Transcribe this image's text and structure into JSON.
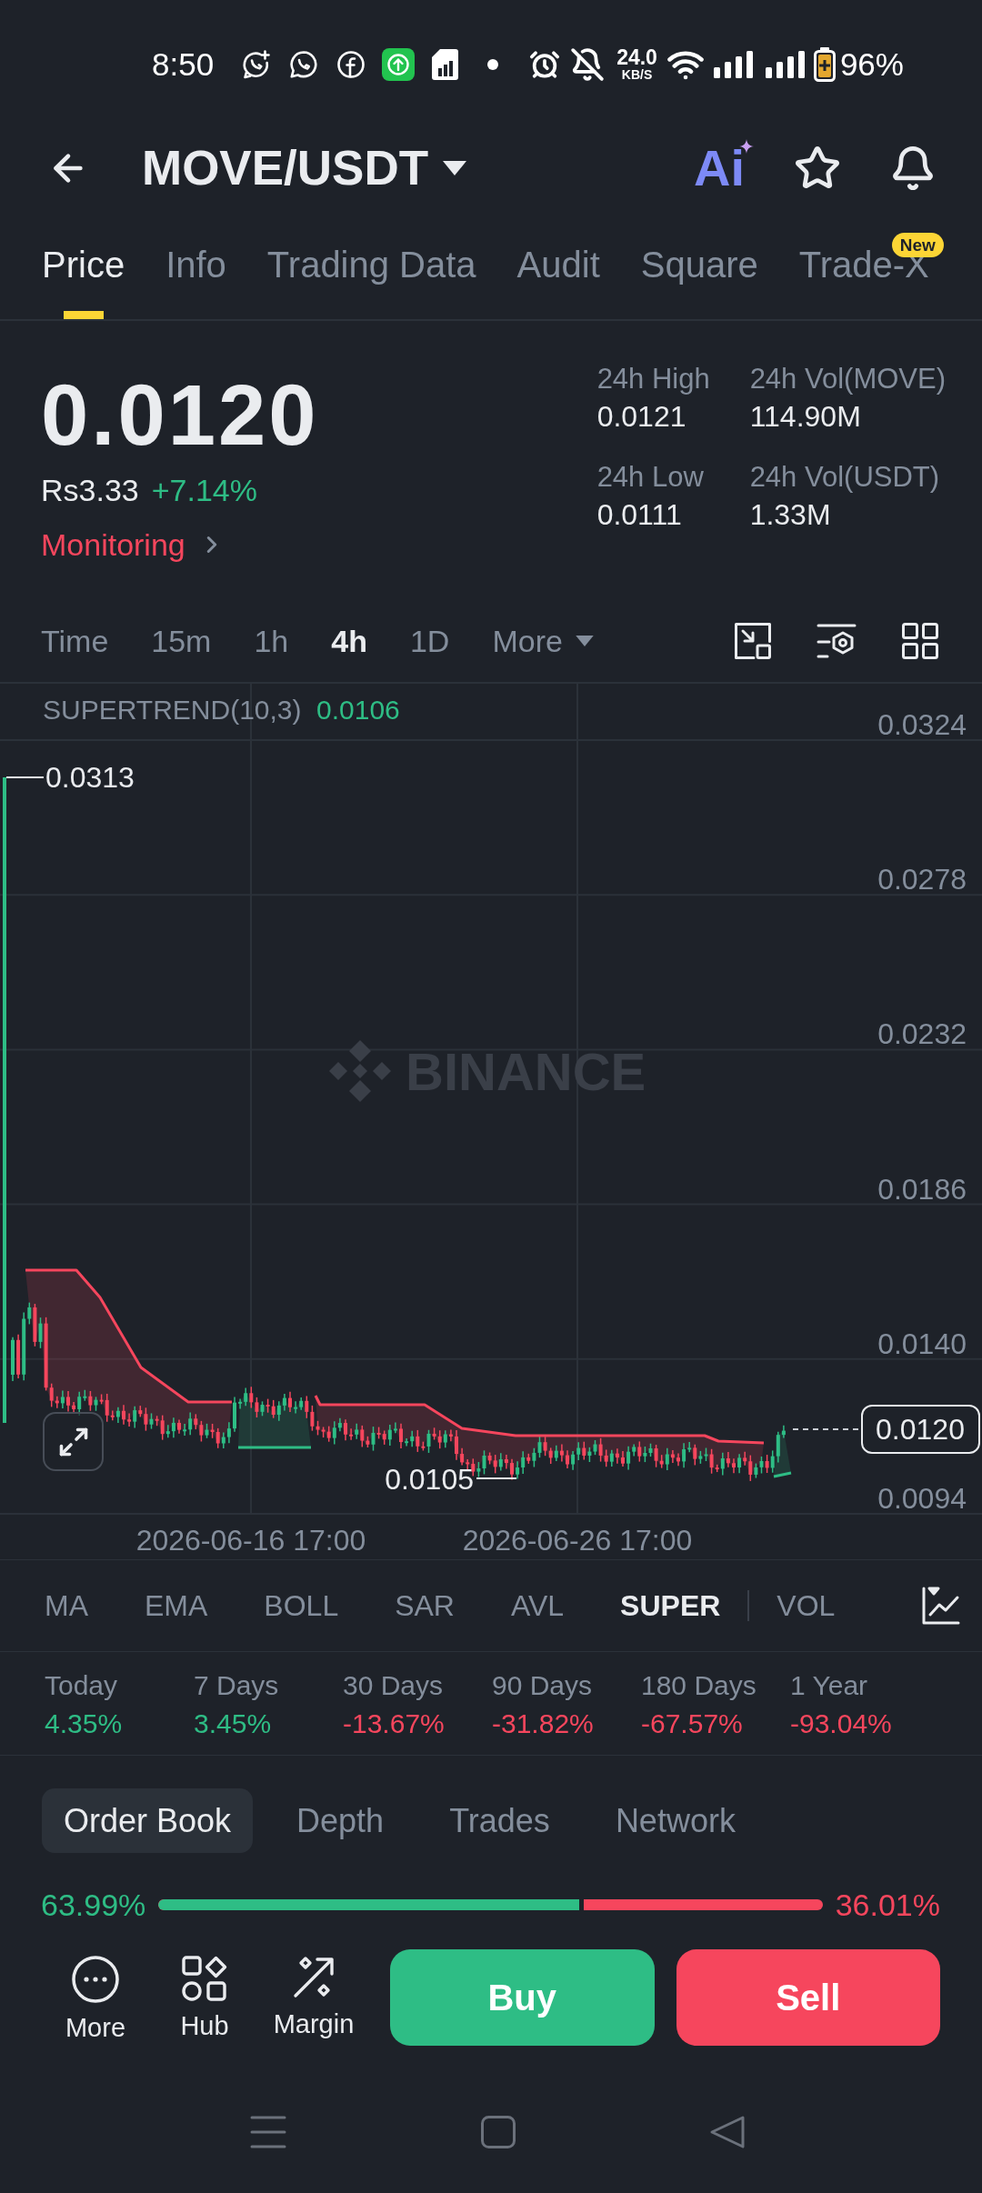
{
  "status_bar": {
    "time": "8:50",
    "net_speed": "24.0",
    "net_speed_unit": "KB/S",
    "battery": "96%"
  },
  "header": {
    "pair": "MOVE/USDT",
    "ai_label": "Ai"
  },
  "tabs": [
    {
      "label": "Price",
      "selected": true
    },
    {
      "label": "Info",
      "selected": false
    },
    {
      "label": "Trading Data",
      "selected": false
    },
    {
      "label": "Audit",
      "selected": false
    },
    {
      "label": "Square",
      "selected": false
    },
    {
      "label": "Trade-X",
      "selected": false,
      "badge": "New"
    }
  ],
  "price": {
    "last": "0.0120",
    "fiat": "Rs3.33",
    "change": "+7.14%",
    "monitoring": "Monitoring"
  },
  "stats": [
    {
      "label": "24h High",
      "value": "0.0121"
    },
    {
      "label": "24h Vol(MOVE)",
      "value": "114.90M"
    },
    {
      "label": "24h Low",
      "value": "0.0111"
    },
    {
      "label": "24h Vol(USDT)",
      "value": "1.33M"
    }
  ],
  "intervals": [
    {
      "label": "Time",
      "kind": "option",
      "selected": false
    },
    {
      "label": "15m",
      "kind": "option",
      "selected": false
    },
    {
      "label": "1h",
      "kind": "option",
      "selected": false
    },
    {
      "label": "4h",
      "kind": "option",
      "selected": true
    },
    {
      "label": "1D",
      "kind": "option",
      "selected": false
    },
    {
      "label": "More",
      "kind": "menu",
      "selected": false
    }
  ],
  "chart": {
    "indicator": "SUPERTREND(10,3)",
    "indicator_value": "0.0106",
    "watermark": "BINANCE",
    "price_ticks": [
      "0.0324",
      "0.0278",
      "0.0232",
      "0.0186",
      "0.0140",
      "0.0094"
    ],
    "time_labels": [
      "2026-06-16 17:00",
      "2026-06-26 17:00"
    ],
    "high_marker": "0.0313",
    "low_marker": "0.0105",
    "last_price": "0.0120"
  },
  "main_indicators": [
    {
      "label": "MA",
      "selected": false
    },
    {
      "label": "EMA",
      "selected": false
    },
    {
      "label": "BOLL",
      "selected": false
    },
    {
      "label": "SAR",
      "selected": false
    },
    {
      "label": "AVL",
      "selected": false
    },
    {
      "label": "SUPER",
      "selected": true
    }
  ],
  "sub_indicators": [
    {
      "label": "VOL",
      "selected": false
    }
  ],
  "performance": [
    {
      "period": "Today",
      "change": "4.35%",
      "color": "#2ebd85"
    },
    {
      "period": "7 Days",
      "change": "3.45%",
      "color": "#2ebd85"
    },
    {
      "period": "30 Days",
      "change": "-13.67%",
      "color": "#f6465d"
    },
    {
      "period": "90 Days",
      "change": "-31.82%",
      "color": "#f6465d"
    },
    {
      "period": "180 Days",
      "change": "-67.57%",
      "color": "#f6465d"
    },
    {
      "period": "1 Year",
      "change": "-93.04%",
      "color": "#f6465d"
    }
  ],
  "book_tabs": [
    {
      "label": "Order Book",
      "selected": true
    },
    {
      "label": "Depth",
      "selected": false
    },
    {
      "label": "Trades",
      "selected": false
    },
    {
      "label": "Network",
      "selected": false
    }
  ],
  "ratio": {
    "buy": "63.99%",
    "sell": "36.01%",
    "level": 0.6399
  },
  "tools": [
    {
      "label": "More",
      "kind": "more"
    },
    {
      "label": "Hub",
      "kind": "hub"
    },
    {
      "label": "Margin",
      "kind": "margin"
    }
  ],
  "trade": [
    {
      "label": "Buy",
      "kind": "buy"
    },
    {
      "label": "Sell",
      "kind": "sell"
    }
  ]
}
